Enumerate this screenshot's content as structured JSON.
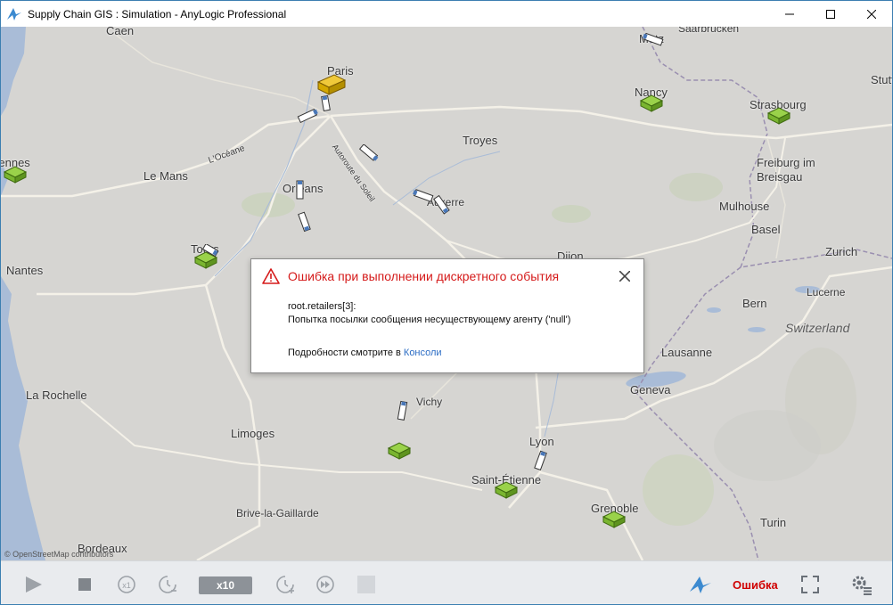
{
  "window": {
    "title": "Supply Chain GIS : Simulation - AnyLogic Professional"
  },
  "map": {
    "attribution": "© OpenStreetMap contributors",
    "cities": [
      {
        "name": "Caen"
      },
      {
        "name": "Paris"
      },
      {
        "name": "Nancy"
      },
      {
        "name": "Strasbourg"
      },
      {
        "name": "Troyes"
      },
      {
        "name": "Rennes"
      },
      {
        "name": "Le Mans"
      },
      {
        "name": "Orléans"
      },
      {
        "name": "Auxerre"
      },
      {
        "name": "Freiburg im Breisgau"
      },
      {
        "name": "Mulhouse"
      },
      {
        "name": "Basel"
      },
      {
        "name": "Zurich"
      },
      {
        "name": "Tours"
      },
      {
        "name": "Nantes"
      },
      {
        "name": "Dijon"
      },
      {
        "name": "Lucerne"
      },
      {
        "name": "Bern"
      },
      {
        "name": "Lausanne"
      },
      {
        "name": "Geneva"
      },
      {
        "name": "La Rochelle"
      },
      {
        "name": "Vichy"
      },
      {
        "name": "Limoges"
      },
      {
        "name": "Lyon"
      },
      {
        "name": "Saint-Étienne"
      },
      {
        "name": "Grenoble"
      },
      {
        "name": "Brive-la-Gaillarde"
      },
      {
        "name": "Turin"
      },
      {
        "name": "Bordeaux"
      },
      {
        "name": "Metz"
      },
      {
        "name": "Saarbrücken"
      },
      {
        "name": "Stuttgart"
      }
    ],
    "country_label": "Switzerland",
    "road_labels": [
      "L'Océane",
      "Autoroute du Soleil"
    ]
  },
  "dialog": {
    "title": "Ошибка при выполнении дискретного события",
    "line1": "root.retailers[3]:",
    "line2": "Попытка посылки сообщения несуществующему агенту ('null')",
    "more_prefix": "Подробности смотрите в ",
    "more_link": "Консоли"
  },
  "toolbar": {
    "speed": "x10",
    "status": "Ошибка"
  },
  "colors": {
    "accent": "#3c7fb1",
    "error": "#d51a1a",
    "retailer": "#8cc63f",
    "distributor": "#e0b000"
  }
}
